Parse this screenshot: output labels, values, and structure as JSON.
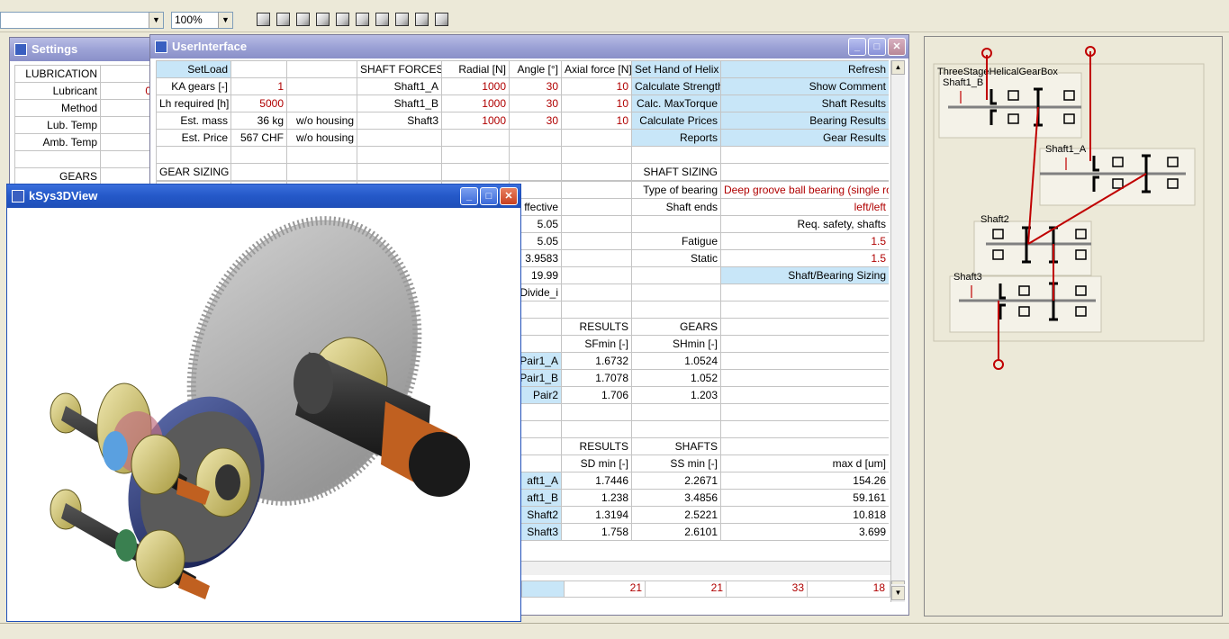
{
  "toolbar": {
    "combo1_value": "",
    "zoom_value": "100%",
    "view_icons": [
      "view-iso-icon",
      "view-front-icon",
      "view-back-icon",
      "view-left-icon",
      "view-right-icon",
      "view-top-icon",
      "view-bottom-icon",
      "view-rotate-icon",
      "view-rotate-left-icon",
      "view-rotate-right-icon"
    ]
  },
  "settings_window": {
    "title": "Settings",
    "rows": [
      {
        "label": "LUBRICATION",
        "value": ""
      },
      {
        "label": "Lubricant",
        "value": "0"
      },
      {
        "label": "Method",
        "value": ""
      },
      {
        "label": "Lub. Temp",
        "value": ""
      },
      {
        "label": "Amb. Temp",
        "value": ""
      },
      {
        "label": "",
        "value": ""
      },
      {
        "label": "GEARS",
        "value": ""
      }
    ]
  },
  "ui_window": {
    "title": "UserInterface",
    "top_rows": [
      [
        "SetLoad",
        "",
        "",
        "SHAFT FORCES",
        "Radial [N]",
        "Angle [°]",
        "Axial force [N]",
        "Set Hand of Helix",
        "Refresh"
      ],
      [
        "KA gears [-]",
        "1",
        "",
        "Shaft1_A",
        "1000",
        "30",
        "10",
        "Calculate Strength",
        "Show Comment"
      ],
      [
        "Lh required [h]",
        "5000",
        "",
        "Shaft1_B",
        "1000",
        "30",
        "10",
        "Calc. MaxTorque",
        "Shaft Results"
      ],
      [
        "Est. mass",
        "36 kg",
        "w/o housing",
        "Shaft3",
        "1000",
        "30",
        "10",
        "Calculate Prices",
        "Bearing Results"
      ],
      [
        "Est. Price",
        "567 CHF",
        "w/o housing",
        "",
        "",
        "",
        "",
        "Reports",
        "Gear Results"
      ],
      [
        "",
        "",
        "",
        "",
        "",
        "",
        "",
        "",
        ""
      ],
      [
        "GEAR SIZING",
        "",
        "",
        "",
        "",
        "",
        "",
        "SHAFT SIZING",
        ""
      ]
    ],
    "lower_rows": [
      [
        "",
        "",
        "",
        "",
        "",
        "Type of bearing",
        "Deep groove ball bearing (single row)"
      ],
      [
        "",
        "",
        "",
        "ffective",
        "",
        "Shaft ends",
        "left/left"
      ],
      [
        "",
        "",
        "",
        "5.05",
        "",
        "",
        "Req. safety, shafts"
      ],
      [
        "",
        "",
        "",
        "5.05",
        "",
        "Fatigue",
        "1.5"
      ],
      [
        "",
        "",
        "",
        "3.9583",
        "",
        "Static",
        "1.5"
      ],
      [
        "",
        "",
        "",
        "19.99",
        "",
        "",
        "Shaft/Bearing Sizing"
      ],
      [
        "",
        "",
        "",
        "Divide_i",
        "",
        "",
        ""
      ],
      [
        "",
        "",
        "",
        "",
        "",
        "",
        ""
      ],
      [
        "",
        "",
        "",
        "",
        "RESULTS",
        "GEARS",
        ""
      ],
      [
        "",
        "",
        "",
        "",
        "SFmin [-]",
        "SHmin [-]",
        ""
      ],
      [
        "",
        "",
        "",
        "Pair1_A",
        "1.6732",
        "1.0524",
        ""
      ],
      [
        "",
        "",
        "",
        "Pair1_B",
        "1.7078",
        "1.052",
        ""
      ],
      [
        "",
        "",
        "",
        "Pair2",
        "1.706",
        "1.203",
        ""
      ],
      [
        "",
        "",
        "",
        "",
        "",
        "",
        ""
      ],
      [
        "",
        "",
        "",
        "",
        "",
        "",
        ""
      ],
      [
        "",
        "",
        "",
        "",
        "RESULTS",
        "SHAFTS",
        ""
      ],
      [
        "",
        "",
        "",
        "",
        "SD min [-]",
        "SS min [-]",
        "max d [um]"
      ],
      [
        "",
        "",
        "",
        "aft1_A",
        "1.7446",
        "2.2671",
        "154.26"
      ],
      [
        "",
        "",
        "",
        "aft1_B",
        "1.238",
        "3.4856",
        "59.161"
      ],
      [
        "",
        "",
        "",
        "Shaft2",
        "1.3194",
        "2.5221",
        "10.818"
      ],
      [
        "",
        "",
        "",
        "Shaft3",
        "1.758",
        "2.6101",
        "3.699"
      ]
    ],
    "bottom_values": [
      "21",
      "21",
      "33",
      "18"
    ]
  },
  "view3d_window": {
    "title": "kSys3DView"
  },
  "schematic": {
    "title": "ThreeStageHelicalGearBox",
    "labels": [
      "Shaft1_B",
      "Shaft1_A",
      "Shaft2",
      "Shaft3"
    ]
  },
  "colors": {
    "title_active": "#2458c8",
    "title_inactive": "#9ca2d6",
    "highlight_cell": "#c8e6f8",
    "value_red": "#b00000",
    "schematic_red": "#c00000"
  }
}
